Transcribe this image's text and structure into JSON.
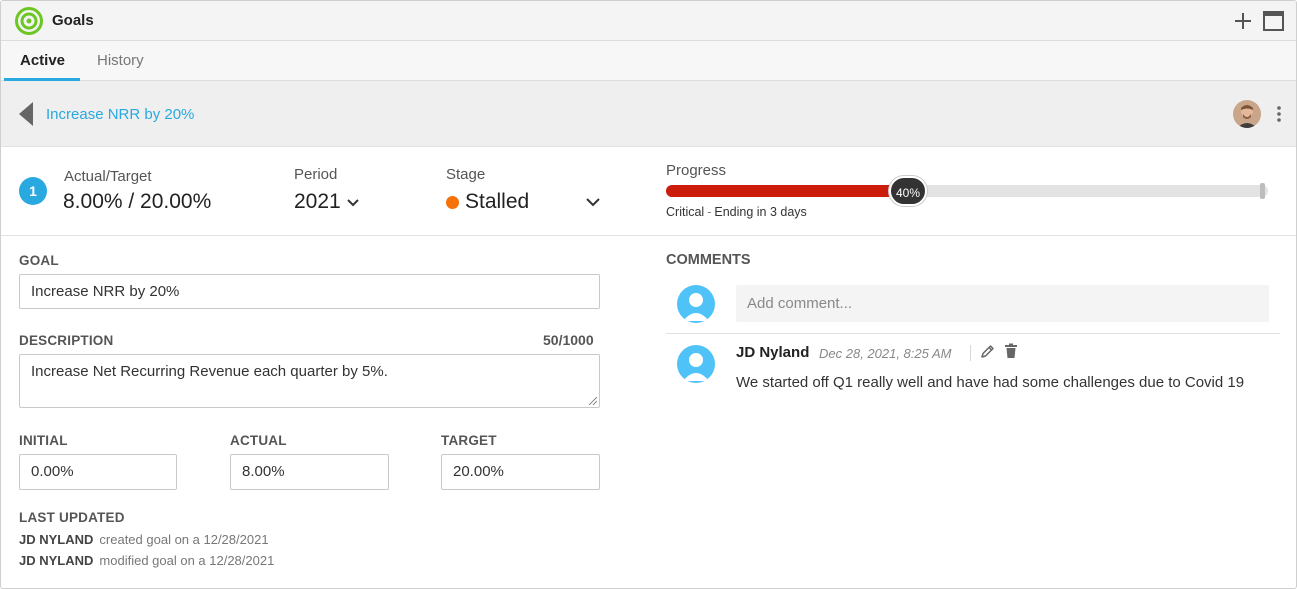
{
  "app": {
    "title": "Goals"
  },
  "tabs": [
    {
      "label": "Active",
      "active": true
    },
    {
      "label": "History",
      "active": false
    }
  ],
  "breadcrumb": {
    "label": "Increase NRR by 20%"
  },
  "stats": {
    "badge": "1",
    "actual_target_label": "Actual/Target",
    "actual_target_value": "8.00% / 20.00%",
    "period_label": "Period",
    "period_value": "2021",
    "stage_label": "Stage",
    "stage_value": "Stalled",
    "stage_color": "#f5720a",
    "progress_label": "Progress",
    "progress_percent": 40,
    "progress_text": "40%",
    "progress_color": "#cc1c0c",
    "progress_status": "Critical",
    "progress_separator": "-",
    "progress_ending": "Ending in 3 days"
  },
  "form": {
    "goal_label": "GOAL",
    "goal_value": "Increase NRR by 20%",
    "description_label": "DESCRIPTION",
    "description_counter": "50/1000",
    "description_value": "Increase Net Recurring Revenue each quarter by 5%.",
    "initial_label": "INITIAL",
    "initial_value": "0.00%",
    "actual_label": "ACTUAL",
    "actual_value": "8.00%",
    "target_label": "TARGET",
    "target_value": "20.00%"
  },
  "last_updated": {
    "label": "LAST UPDATED",
    "entries": [
      {
        "user": "JD NYLAND",
        "text": "created goal on a 12/28/2021"
      },
      {
        "user": "JD NYLAND",
        "text": "modified goal on a 12/28/2021"
      }
    ]
  },
  "comments": {
    "title": "COMMENTS",
    "placeholder": "Add comment...",
    "items": [
      {
        "author": "JD Nyland",
        "date": "Dec 28, 2021, 8:25 AM",
        "body": "We started off Q1 really well and have had some challenges due to Covid 19"
      }
    ]
  },
  "colors": {
    "accent": "#29a9e0",
    "logo": "#6cc623"
  },
  "icons": [
    "goals-logo-icon",
    "plus-icon",
    "maximize-icon",
    "back-arrow-icon",
    "kebab-menu-icon",
    "chevron-down-icon",
    "pencil-icon",
    "trash-icon",
    "user-icon"
  ]
}
